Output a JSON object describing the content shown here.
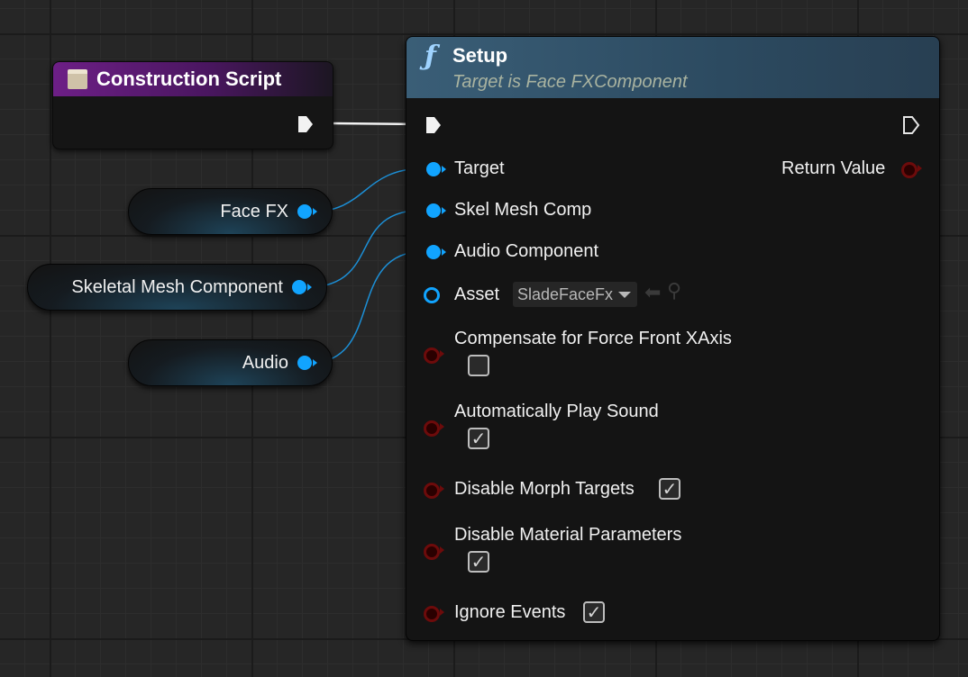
{
  "construction_script": {
    "title": "Construction Script"
  },
  "variables": [
    {
      "label": "Face FX"
    },
    {
      "label": "Skeletal Mesh Component"
    },
    {
      "label": "Audio"
    }
  ],
  "setup_node": {
    "title": "Setup",
    "subtitle": "Target is Face FXComponent",
    "inputs": {
      "target": "Target",
      "skel_mesh_comp": "Skel Mesh Comp",
      "audio_component": "Audio Component",
      "asset": "Asset",
      "asset_value": "SladeFaceFx",
      "compensate": "Compensate for Force Front XAxis",
      "auto_play": "Automatically Play Sound",
      "disable_morph": "Disable Morph Targets",
      "disable_material": "Disable Material Parameters",
      "ignore_events": "Ignore Events"
    },
    "outputs": {
      "return_value": "Return Value"
    },
    "checkbox_states": {
      "compensate": false,
      "auto_play": true,
      "disable_morph": true,
      "disable_material": true,
      "ignore_events": true
    }
  },
  "colors": {
    "object_pin": "#11a4ff",
    "bool_pin": "#6d0b0b",
    "function_header": "#3a5e77",
    "construction_header": "#6d1f86"
  },
  "icons": {
    "function": "function-icon",
    "construction": "construction-script-icon",
    "use_selected": "arrow-left-icon",
    "browse": "magnifier-icon"
  }
}
